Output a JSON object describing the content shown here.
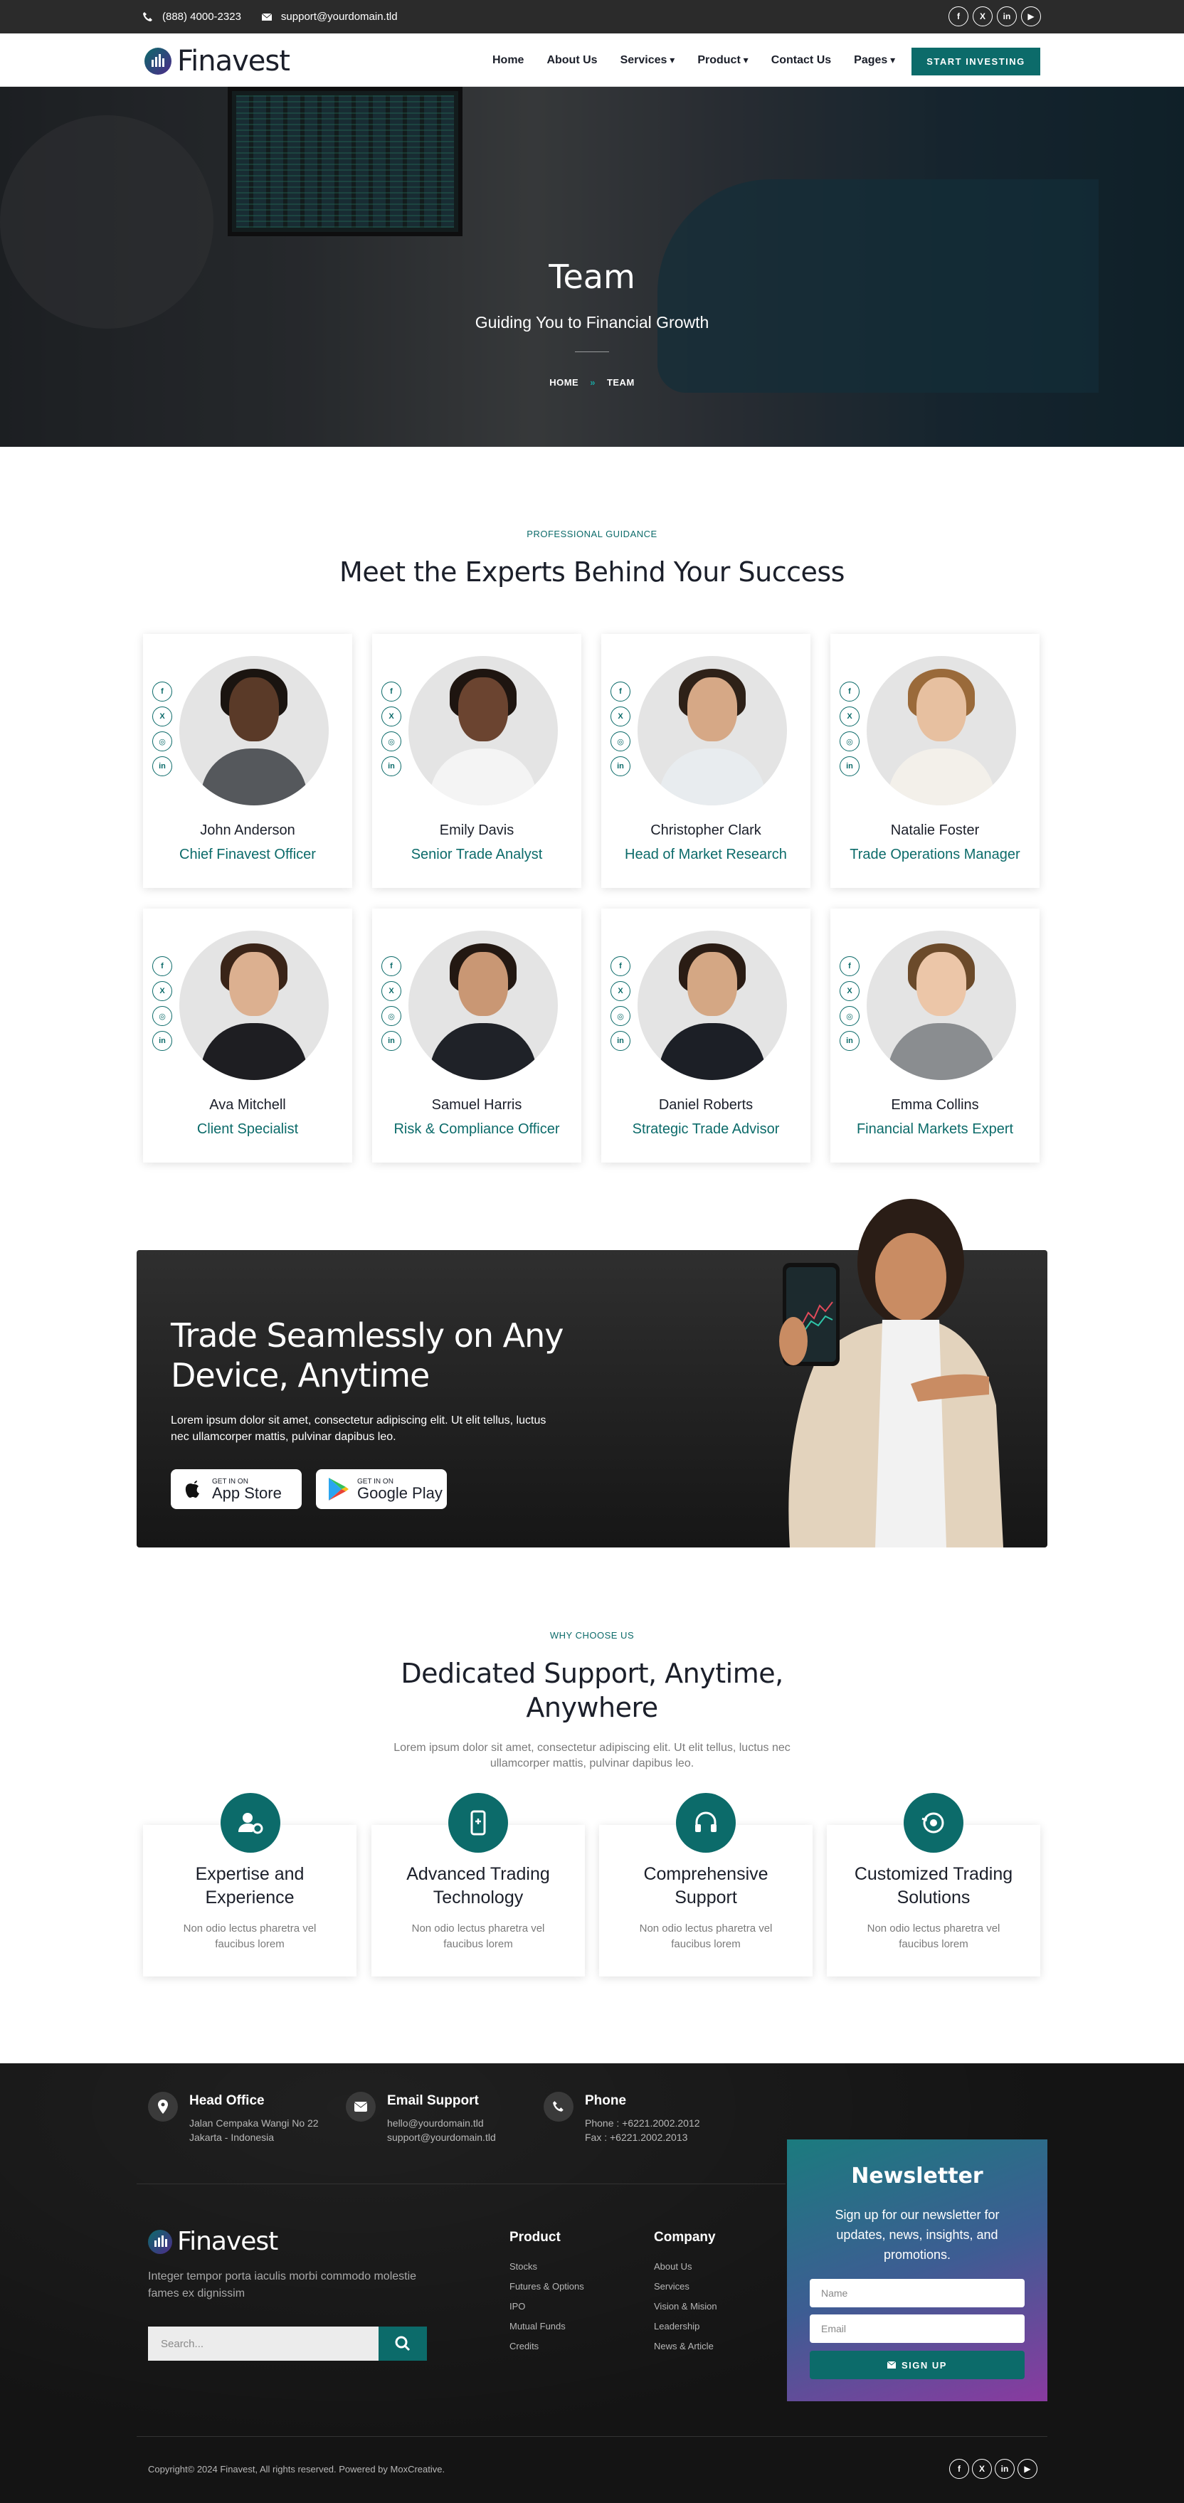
{
  "topbar": {
    "phone": "(888) 4000-2323",
    "email": "support@yourdomain.tld",
    "socials": [
      "f",
      "X",
      "in",
      "▶"
    ]
  },
  "header": {
    "logo": "Finavest",
    "nav": [
      "Home",
      "About Us",
      "Services",
      "Product",
      "Contact Us",
      "Pages"
    ],
    "cta": "START INVESTING"
  },
  "hero": {
    "title": "Team",
    "subtitle": "Guiding You to Financial Growth",
    "breadcrumb": {
      "home": "HOME",
      "sep": "»",
      "current": "TEAM"
    }
  },
  "team": {
    "eyebrow": "PROFESSIONAL GUIDANCE",
    "title": "Meet the Experts Behind Your Success",
    "members": [
      {
        "name": "John Anderson",
        "role": "Chief Finavest Officer"
      },
      {
        "name": "Emily Davis",
        "role": "Senior Trade Analyst"
      },
      {
        "name": "Christopher Clark",
        "role": "Head of Market Research"
      },
      {
        "name": "Natalie Foster",
        "role": "Trade Operations Manager"
      },
      {
        "name": "Ava Mitchell",
        "role": "Client Specialist"
      },
      {
        "name": "Samuel Harris",
        "role": "Risk & Compliance Officer"
      },
      {
        "name": "Daniel Roberts",
        "role": "Strategic Trade Advisor"
      },
      {
        "name": "Emma Collins",
        "role": "Financial Markets Expert"
      }
    ],
    "social_glyphs": [
      "f",
      "X",
      "◎",
      "in"
    ]
  },
  "banner": {
    "title": "Trade Seamlessly on Any Device, Anytime",
    "text": "Lorem ipsum dolor sit amet, consectetur adipiscing elit. Ut elit tellus, luctus nec ullamcorper mattis, pulvinar dapibus leo.",
    "appstore_small": "GET IN ON",
    "appstore_large": "App Store",
    "play_small": "GET IN ON",
    "play_large": "Google Play"
  },
  "why": {
    "eyebrow": "WHY CHOOSE US",
    "title": "Dedicated Support, Anytime, Anywhere",
    "text": "Lorem ipsum dolor sit amet, consectetur adipiscing elit. Ut elit tellus, luctus nec ullamcorper mattis, pulvinar dapibus leo.",
    "features": [
      {
        "title": "Expertise and Experience",
        "text": "Non odio lectus pharetra vel faucibus lorem"
      },
      {
        "title": "Advanced Trading Technology",
        "text": "Non odio lectus pharetra vel faucibus lorem"
      },
      {
        "title": "Comprehensive Support",
        "text": "Non odio lectus pharetra vel faucibus lorem"
      },
      {
        "title": "Customized Trading Solutions",
        "text": "Non odio lectus pharetra vel faucibus lorem"
      }
    ]
  },
  "footer": {
    "office": {
      "title": "Head Office",
      "line1": "Jalan Cempaka Wangi No 22",
      "line2": "Jakarta - Indonesia"
    },
    "email": {
      "title": "Email Support",
      "line1": "hello@yourdomain.tld",
      "line2": "support@yourdomain.tld"
    },
    "phone": {
      "title": "Phone",
      "line1": "Phone : +6221.2002.2012",
      "line2": "Fax : +6221.2002.2013"
    },
    "logo": "Finavest",
    "about": "Integer tempor porta iaculis morbi commodo molestie fames ex dignissim",
    "search_placeholder": "Search...",
    "product": {
      "title": "Product",
      "links": [
        "Stocks",
        "Futures & Options",
        "IPO",
        "Mutual Funds",
        "Credits"
      ]
    },
    "company": {
      "title": "Company",
      "links": [
        "About Us",
        "Services",
        "Vision & Mision",
        "Leadership",
        "News & Article"
      ]
    },
    "newsletter": {
      "title": "Newsletter",
      "text": "Sign up for our newsletter for updates, news, insights, and promotions.",
      "name_placeholder": "Name",
      "email_placeholder": "Email",
      "button": "SIGN UP"
    },
    "copyright": "Copyright© 2024 Finavest, All rights reserved. Powered by MoxCreative."
  },
  "colors": {
    "accent": "#0c6b6a",
    "dark": "#141414"
  }
}
